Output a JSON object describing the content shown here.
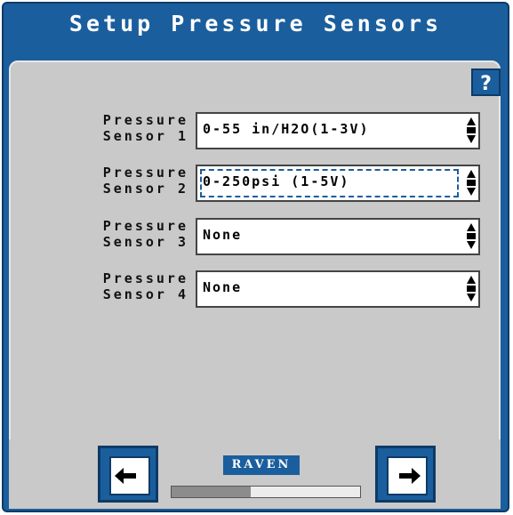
{
  "window": {
    "title": "Setup Pressure Sensors"
  },
  "help": {
    "label": "?"
  },
  "sensors": [
    {
      "label_line1": "Pressure",
      "label_line2": "Sensor 1",
      "value": "0-55 in/H2O(1-3V)",
      "focused": false
    },
    {
      "label_line1": "Pressure",
      "label_line2": "Sensor 2",
      "value": "0-250psi (1-5V)",
      "focused": true
    },
    {
      "label_line1": "Pressure",
      "label_line2": "Sensor 3",
      "value": "None",
      "focused": false
    },
    {
      "label_line1": "Pressure",
      "label_line2": "Sensor 4",
      "value": "None",
      "focused": false
    }
  ],
  "footer": {
    "logo_text": "RAVEN",
    "progress_fraction": 0.42
  },
  "colors": {
    "accent": "#1b5e9d",
    "panel": "#c9c9c9"
  },
  "icons": {
    "back": "back-arrow-icon",
    "next": "next-arrow-icon",
    "spinner": "up-down-spinner-icon"
  }
}
